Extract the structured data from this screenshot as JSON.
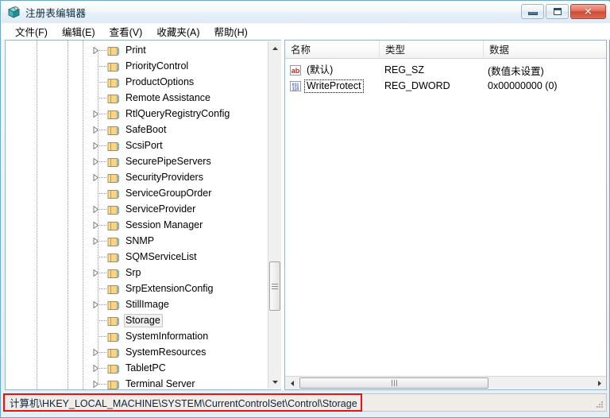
{
  "window": {
    "title": "注册表编辑器",
    "icon": "registry-editor-icon",
    "controls": {
      "minimize": "最小化",
      "maximize": "最大化",
      "close": "✕"
    }
  },
  "menubar": {
    "items": [
      {
        "label": "文件(F)",
        "name": "menu-file"
      },
      {
        "label": "编辑(E)",
        "name": "menu-edit"
      },
      {
        "label": "查看(V)",
        "name": "menu-view"
      },
      {
        "label": "收藏夹(A)",
        "name": "menu-favorites"
      },
      {
        "label": "帮助(H)",
        "name": "menu-help"
      }
    ]
  },
  "tree": {
    "selected": "Storage",
    "items": [
      {
        "label": "Print",
        "expandable": true
      },
      {
        "label": "PriorityControl",
        "expandable": false
      },
      {
        "label": "ProductOptions",
        "expandable": false
      },
      {
        "label": "Remote Assistance",
        "expandable": false
      },
      {
        "label": "RtlQueryRegistryConfig",
        "expandable": true
      },
      {
        "label": "SafeBoot",
        "expandable": true
      },
      {
        "label": "ScsiPort",
        "expandable": true
      },
      {
        "label": "SecurePipeServers",
        "expandable": true
      },
      {
        "label": "SecurityProviders",
        "expandable": true
      },
      {
        "label": "ServiceGroupOrder",
        "expandable": false
      },
      {
        "label": "ServiceProvider",
        "expandable": true
      },
      {
        "label": "Session Manager",
        "expandable": true
      },
      {
        "label": "SNMP",
        "expandable": true
      },
      {
        "label": "SQMServiceList",
        "expandable": false
      },
      {
        "label": "Srp",
        "expandable": true
      },
      {
        "label": "SrpExtensionConfig",
        "expandable": false
      },
      {
        "label": "StillImage",
        "expandable": true
      },
      {
        "label": "Storage",
        "expandable": false,
        "selected": true
      },
      {
        "label": "SystemInformation",
        "expandable": false
      },
      {
        "label": "SystemResources",
        "expandable": true
      },
      {
        "label": "TabletPC",
        "expandable": true
      },
      {
        "label": "Terminal Server",
        "expandable": true
      }
    ]
  },
  "list": {
    "columns": [
      {
        "label": "名称",
        "name": "column-name"
      },
      {
        "label": "类型",
        "name": "column-type"
      },
      {
        "label": "数据",
        "name": "column-data"
      }
    ],
    "rows": [
      {
        "name": "(默认)",
        "type": "REG_SZ",
        "data": "(数值未设置)",
        "icon": "string-value-icon",
        "focused": false
      },
      {
        "name": "WriteProtect",
        "type": "REG_DWORD",
        "data": "0x00000000 (0)",
        "icon": "dword-value-icon",
        "focused": true
      }
    ]
  },
  "statusbar": {
    "path": "计算机\\HKEY_LOCAL_MACHINE\\SYSTEM\\CurrentControlSet\\Control\\Storage"
  },
  "colors": {
    "annotation": "#ee1111",
    "window_border": "#6fa8c8",
    "close_button": "#cf4a33",
    "folder": "#fcd984",
    "string_icon": "#c2281c",
    "dword_icon": "#2b57c4"
  }
}
